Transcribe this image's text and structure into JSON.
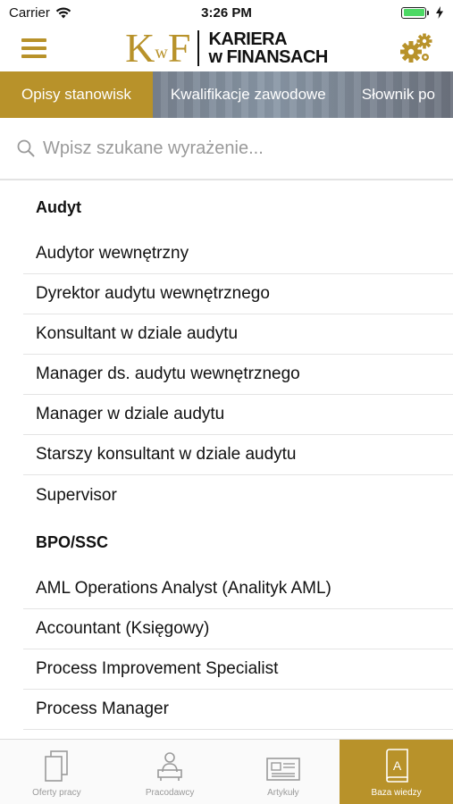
{
  "status_bar": {
    "carrier": "Carrier",
    "time": "3:26 PM"
  },
  "header": {
    "logo_mark": {
      "k": "K",
      "w": "w",
      "f": "F"
    },
    "logo_line1": "KARIERA",
    "logo_line2": "w FINANSACH",
    "accent_color": "#b8922a"
  },
  "tabs": [
    {
      "label": "Opisy stanowisk",
      "active": true
    },
    {
      "label": "Kwalifikacje zawodowe",
      "active": false
    },
    {
      "label": "Słownik po",
      "active": false
    }
  ],
  "search": {
    "placeholder": "Wpisz szukane wyrażenie...",
    "value": ""
  },
  "sections": [
    {
      "title": "Audyt",
      "items": [
        "Audytor wewnętrzny",
        "Dyrektor audytu wewnętrznego",
        "Konsultant w dziale audytu",
        "Manager ds. audytu wewnętrznego",
        "Manager w dziale audytu",
        "Starszy konsultant w dziale audytu",
        "Supervisor"
      ]
    },
    {
      "title": "BPO/SSC",
      "items": [
        "AML Operations Analyst (Analityk AML)",
        "Accountant (Księgowy)",
        "Process Improvement Specialist",
        "Process Manager"
      ]
    }
  ],
  "tabbar": [
    {
      "label": "Oferty pracy",
      "icon": "documents-icon",
      "active": false
    },
    {
      "label": "Pracodawcy",
      "icon": "employer-icon",
      "active": false
    },
    {
      "label": "Artykuły",
      "icon": "newspaper-icon",
      "active": false
    },
    {
      "label": "Baza wiedzy",
      "icon": "book-icon",
      "active": true
    }
  ]
}
